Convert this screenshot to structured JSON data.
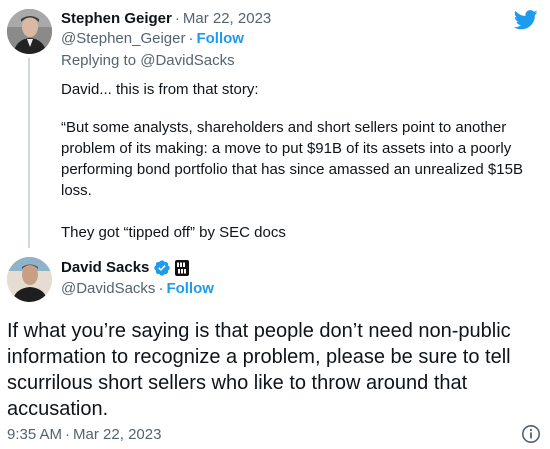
{
  "reply": {
    "name": "Stephen Geiger",
    "date": "Mar 22, 2023",
    "handle": "@Stephen_Geiger",
    "follow_label": "Follow",
    "replying_to_prefix": "Replying to ",
    "replying_to_handle": "@DavidSacks",
    "text_line1": "David... this is from that story:",
    "text_quote": "“But some analysts, shareholders and short sellers point to another problem of its making: a move to put $91B of its assets into a poorly performing bond portfolio that has since amassed an unrealized $15B loss.",
    "text_last": "They got “tipped off” by SEC docs"
  },
  "main": {
    "name": "David Sacks",
    "handle": "@DavidSacks",
    "follow_label": "Follow",
    "text": "If what you’re saying is that people don’t need non-public information to recognize a problem, please be sure to tell scurrilous short sellers who like to throw around that accusation.",
    "time": "9:35 AM",
    "date": "Mar 22, 2023"
  },
  "separator": "·",
  "colors": {
    "link": "#1d9bf0",
    "muted": "#536471",
    "text": "#0f1419",
    "verified": "#1d9bf0"
  },
  "icons": {
    "brand": "twitter-bird-icon",
    "verified": "verified-badge-icon",
    "affiliate": "all-in-affiliate-badge",
    "info": "info-icon"
  }
}
